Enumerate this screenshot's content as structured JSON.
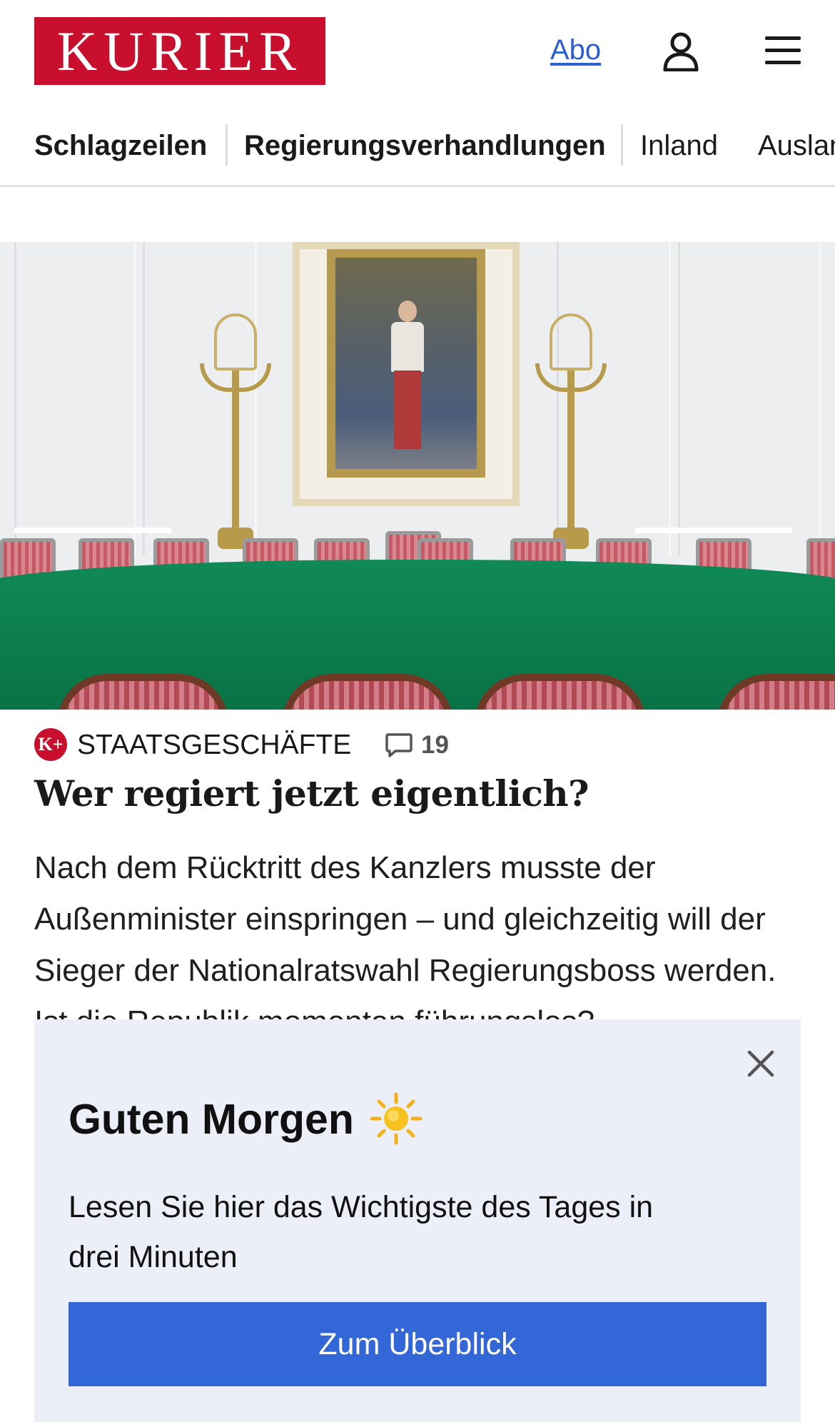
{
  "header": {
    "logo_text": "KURIER",
    "abo_label": "Abo",
    "user_icon": "user-icon",
    "menu_icon": "hamburger-menu-icon"
  },
  "nav": {
    "items": [
      "Schlagzeilen",
      "Regierungsverhandlungen",
      "Inland",
      "Ausland"
    ]
  },
  "article": {
    "badge": "K+",
    "category": "STAATSGESCHÄFTE",
    "comment_count": "19",
    "headline": "Wer regiert jetzt eigentlich?",
    "teaser": "Nach dem Rücktritt des Kanzlers musste der Außenminister einspringen – und gleichzeitig will der Sieger der Nationalratswahl Regierungsboss werden. Ist die Republik momentan führungslos?"
  },
  "overlay": {
    "title": "Guten Morgen",
    "title_icon": "sun-icon",
    "text": "Lesen Sie hier das Wichtigste des Tages in drei Minuten",
    "button_label": "Zum Überblick",
    "close_icon": "close-icon"
  },
  "colors": {
    "brand": "#c8102e",
    "link": "#2d5fcf",
    "button": "#3366d6",
    "overlay_bg": "#eceef8"
  }
}
